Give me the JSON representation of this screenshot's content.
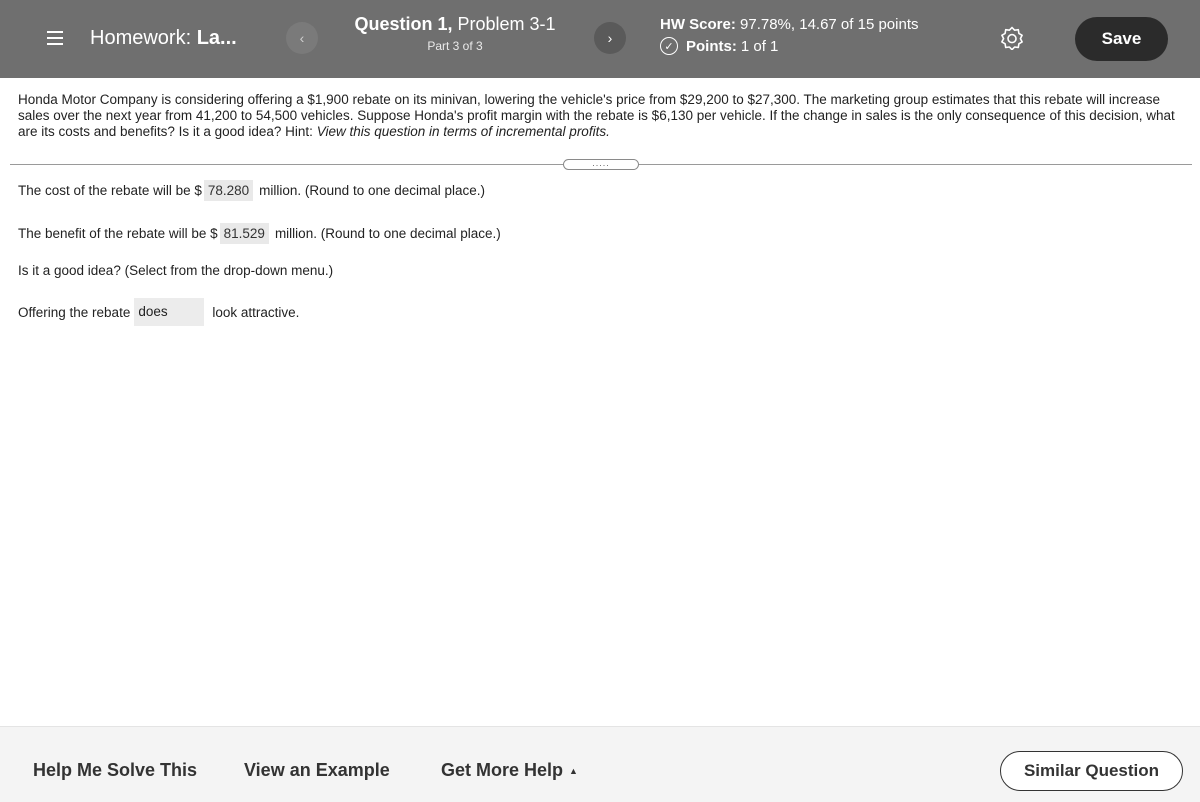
{
  "header": {
    "homework_prefix": "Homework:",
    "homework_name": "La...",
    "question_title": "Question 1,",
    "question_problem": "Problem 3-1",
    "part": "Part 3 of 3",
    "hw_score_label": "HW Score:",
    "hw_score_value": "97.78%, 14.67 of 15 points",
    "points_label": "Points:",
    "points_value": "1 of 1",
    "save_label": "Save",
    "prev_icon": "‹",
    "next_icon": "›",
    "check_icon": "✓"
  },
  "problem": {
    "text": "Honda Motor Company is considering offering a $1,900 rebate on its minivan, lowering the vehicle's price from $29,200 to $27,300. The marketing group estimates that this rebate will increase sales over the next year from 41,200 to 54,500 vehicles. Suppose Honda's profit margin with the rebate is $6,130 per vehicle. If the change in sales is the only consequence of this decision, what are its costs and benefits? Is it a good idea? Hint: ",
    "hint": "View this question in terms of incremental profits."
  },
  "answers": {
    "cost_prefix": "The cost of the rebate will be $",
    "cost_value": "78.280",
    "cost_suffix": "million.  (Round to one decimal place.)",
    "benefit_prefix": "The benefit of the rebate will be $",
    "benefit_value": "81.529",
    "benefit_suffix": "million.  (Round to one decimal place.)",
    "question": "Is it a good idea?  (Select from the drop-down menu.)",
    "offer_prefix": "Offering the rebate",
    "offer_selected": "does",
    "offer_suffix": "look attractive."
  },
  "footer": {
    "help_solve": "Help Me Solve This",
    "view_example": "View an Example",
    "more_help": "Get More Help",
    "similar": "Similar Question"
  },
  "colors": {
    "header_bg": "#6f6f6f",
    "save_bg": "#2b2b2b",
    "answer_bg": "#e9e9e9"
  }
}
